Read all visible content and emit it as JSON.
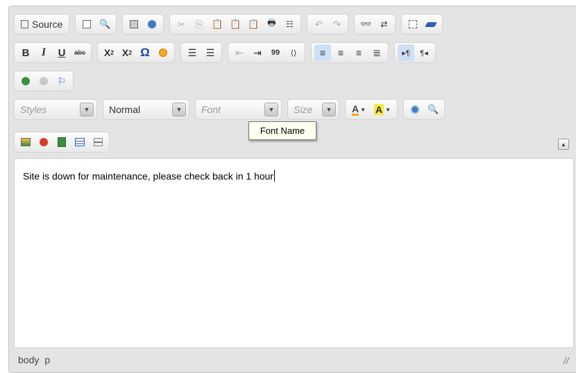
{
  "toolbar": {
    "row1": {
      "source_label": "Source"
    },
    "row2": {
      "bold": "B",
      "italic": "I",
      "underline": "U",
      "strike": "abc",
      "subscript": "X",
      "subscript_mark": "2",
      "superscript": "X",
      "superscript_mark": "2",
      "special_char": "Ω",
      "quote": "99"
    },
    "row4": {
      "styles_placeholder": "Styles",
      "format_value": "Normal",
      "font_placeholder": "Font",
      "size_placeholder": "Size",
      "text_color": "A",
      "bg_color": "A"
    }
  },
  "tooltip": {
    "text": "Font Name"
  },
  "content": {
    "text": "Site is down for maintenance, please check back in 1 hour"
  },
  "elements_path": [
    "body",
    "p"
  ],
  "colors": {
    "chrome": "#e4e4e4",
    "active_button": "#cfe0f4",
    "accent_blue": "#1a4d9e",
    "smiley": "#f5a623"
  }
}
